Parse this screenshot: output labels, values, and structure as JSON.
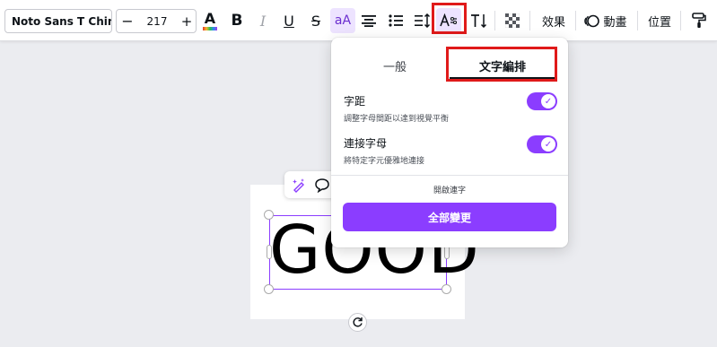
{
  "toolbar": {
    "font_family": "Noto Sans T Chin...",
    "font_size": "217",
    "minus": "−",
    "plus": "+",
    "text_color_glyph": "A",
    "bold_glyph": "B",
    "italic_glyph": "I",
    "underline_glyph": "U",
    "strike_glyph": "S",
    "case_glyph": "aA",
    "effects_label": "效果",
    "animate_label": "動畫",
    "position_label": "位置"
  },
  "popover": {
    "tab_general": "一般",
    "tab_typography": "文字編排",
    "kerning_title": "字距",
    "kerning_desc": "調整字母間距以達到視覺平衡",
    "ligature_title": "連接字母",
    "ligature_desc": "將特定字元優雅地連接",
    "more_link": "開啟連字",
    "apply_button": "全部變更",
    "kerning_on": true,
    "ligature_on": true
  },
  "canvas": {
    "text": "GOOD"
  },
  "colors": {
    "accent": "#8b3dff",
    "highlight": "#e01a1a"
  },
  "icons": [
    "text-color-icon",
    "align-icon",
    "list-icon",
    "spacing-icon",
    "text-style-icon",
    "vertical-text-icon",
    "transparency-icon",
    "animate-icon",
    "paint-roller-icon",
    "magic-edit-icon",
    "comment-icon",
    "rotate-icon"
  ]
}
